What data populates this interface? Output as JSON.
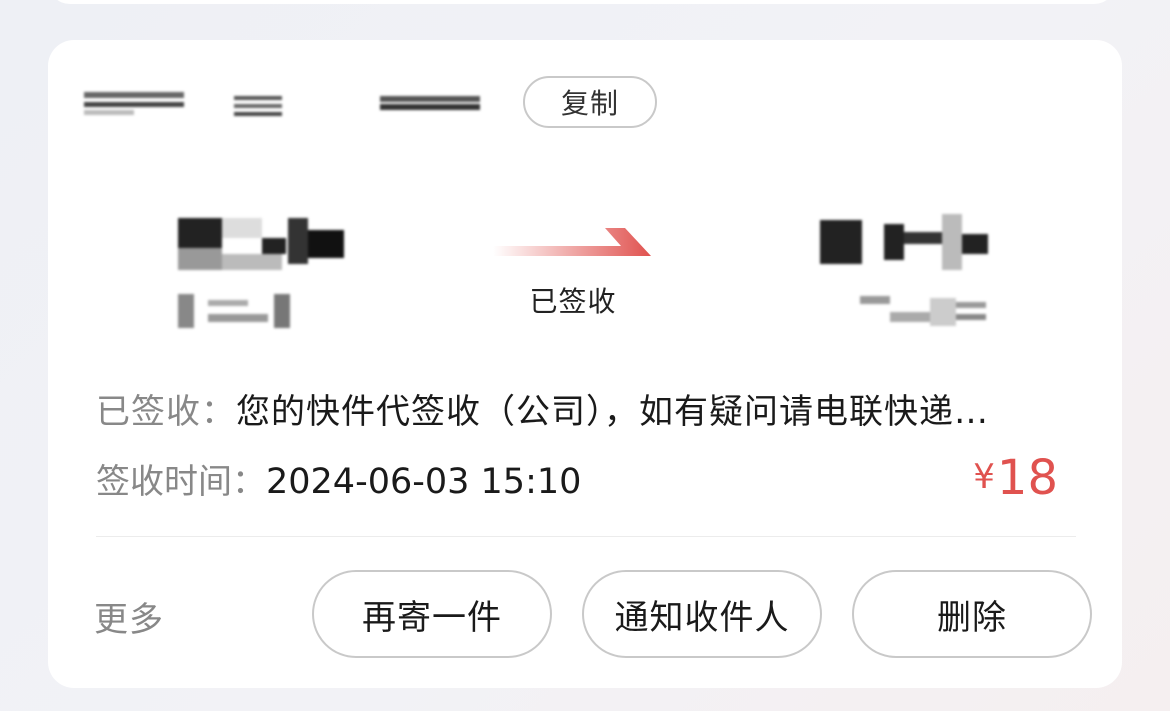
{
  "order": {
    "copy_label": "复制",
    "status_label": "已签收",
    "detail_label": "已签收：",
    "detail_text": "您的快件代签收（公司），如有疑问请电联快递…",
    "time_label": "签收时间：",
    "time_value": "2024-06-03 15:10",
    "price_symbol": "¥",
    "price_value": "18",
    "accent_color": "#e0524f"
  },
  "actions": {
    "more_label": "更多",
    "resend_label": "再寄一件",
    "notify_label": "通知收件人",
    "delete_label": "删除"
  }
}
